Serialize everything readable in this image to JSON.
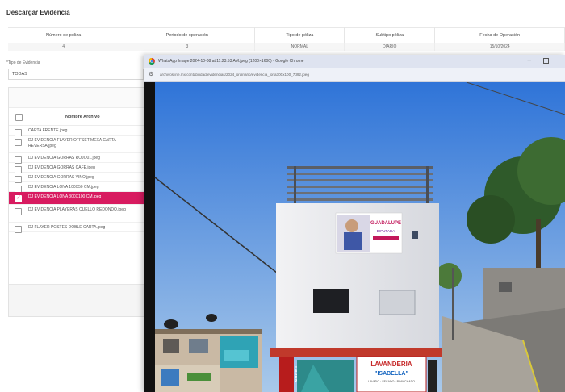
{
  "page": {
    "title": "Descargar Evidencia"
  },
  "policy_table": {
    "headers": [
      "Número de póliza",
      "Periodo de operación",
      "Tipo de póliza",
      "Subtipo póliza",
      "Fecha de Operación"
    ],
    "row": [
      "4",
      "3",
      "NORMAL",
      "DIARIO",
      "15/10/2024"
    ]
  },
  "filter": {
    "label": "*Tipo de Evidencia",
    "value": "TODAS"
  },
  "files": {
    "header": "Nombre Archivo",
    "items": [
      {
        "name": "CARTA FRENTE.jpeg",
        "selected": false
      },
      {
        "name": "DJ EVIDENCIA FLAYER OFFSET MEXA CARTA REVERSA.jpeg",
        "selected": false
      },
      {
        "name": "DJ EVIDENCIA GORRAS ROJO01.jpeg",
        "selected": false
      },
      {
        "name": "DJ EVIDENCIA GORRAS CAFE.jpeg",
        "selected": false
      },
      {
        "name": "DJ EVIDENCIA GORRAS VINO.jpeg",
        "selected": false
      },
      {
        "name": "DJ EVIDENCIA LONA 100X50 CM.jpeg",
        "selected": false
      },
      {
        "name": "DJ EVIDENCIA LONA 300X100 CM.jpeg",
        "selected": true
      },
      {
        "name": "DJ EVIDENCIA PLAYERAS CUELLO REDONDO.jpeg",
        "selected": false
      },
      {
        "name": "DJ FLAYER POSTES DOBLE CARTA.jpeg",
        "selected": false
      }
    ]
  },
  "browser": {
    "title": "WhatsApp Image 2024-10-08 at 11.23.53 AM.jpeg (1200×1600) - Google Chrome",
    "url": "archivos.ine.mx/contabilidad/evidencias/2024_ordinario/evidencia_lona300x100_7d92.jpeg",
    "photo": {
      "sign_text": "LAVANDERIA",
      "sign_subtext": "\"ISABELLA\"",
      "sign_small": "LAVADO · SECADO · PLANCHADO",
      "side_sign": "LAVAN",
      "banner_text": "GUADALUPE",
      "banner_sub": "DIPUTADA"
    }
  }
}
